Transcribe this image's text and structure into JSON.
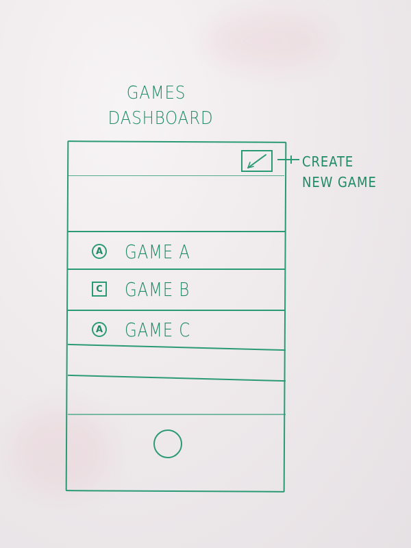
{
  "title": {
    "line1": "GAMES",
    "line2": "DASHBOARD"
  },
  "callout": {
    "line1": "CREATE",
    "line2": "NEW GAME"
  },
  "games": [
    {
      "badge": "A",
      "badge_shape": "circle",
      "label": "GAME A"
    },
    {
      "badge": "C",
      "badge_shape": "square",
      "label": "GAME B"
    },
    {
      "badge": "A",
      "badge_shape": "circle",
      "label": "GAME C"
    }
  ],
  "icons": {
    "create": "pencil-icon",
    "home": "home-button-circle"
  },
  "colors": {
    "marker": "#2a9a74",
    "board": "#efeaec"
  }
}
